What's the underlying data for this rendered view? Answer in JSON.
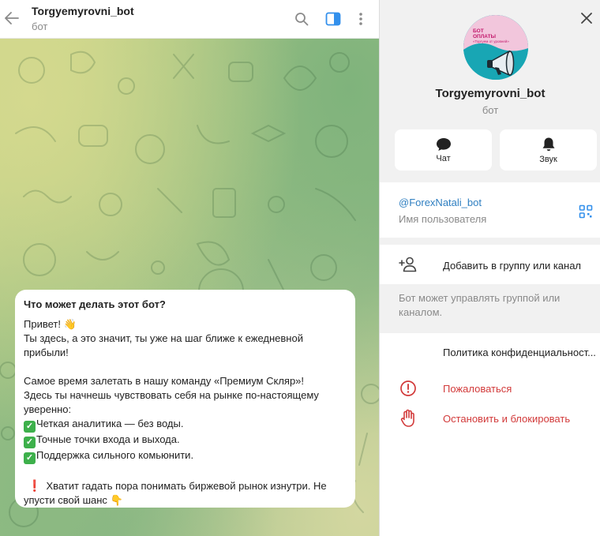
{
  "chat": {
    "title": "Torgyemyrovni_bot",
    "subtitle": "бот",
    "message": {
      "title": "Что может делать этот бот?",
      "greeting": "Привет! 👋",
      "line1": "Ты здесь, а это значит, ты уже на шаг ближе к ежедневной прибыли!",
      "line2": "Самое время залетать в нашу команду «Премиум Скляр»!",
      "line3": "Здесь ты начнешь чувствовать себя на рынке по-настоящему уверенно:",
      "bullets": [
        "Четкая аналитика — без воды.",
        "Точные точки входа и выхода.",
        "Поддержка сильного комьюнити."
      ],
      "closing": "Хватит гадать пора понимать биржевой рынок изнутри. Не упусти свой шанс",
      "closing_emoji": "👇"
    }
  },
  "panel": {
    "avatar_text": [
      "БОТ",
      "ОПЛАТЫ",
      "«Торгуем от уровней»"
    ],
    "name": "Torgyemyrovni_bot",
    "subtitle": "бот",
    "actions": {
      "chat_label": "Чат",
      "sound_label": "Звук"
    },
    "username": "@ForexNatali_bot",
    "username_label": "Имя пользователя",
    "add_to_group": "Добавить в группу или канал",
    "add_hint": "Бот может управлять группой или каналом.",
    "privacy": "Политика конфиденциальност...",
    "report": "Пожаловаться",
    "block": "Остановить и блокировать"
  },
  "colors": {
    "accent": "#3390ec",
    "link": "#2f7fc1",
    "danger": "#d23a3a",
    "check": "#3db04b"
  }
}
